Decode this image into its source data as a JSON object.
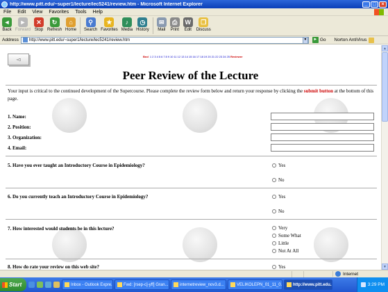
{
  "window": {
    "title": "http://www.pitt.edu/~super1/lecture/lec5241/review.htm - Microsoft Internet Explorer"
  },
  "menu": [
    "File",
    "Edit",
    "View",
    "Favorites",
    "Tools",
    "Help"
  ],
  "toolbar": [
    {
      "label": "Back",
      "icon": "back-arrow-icon",
      "color": "#3a9a3a",
      "glyph": "◄",
      "disabled": false
    },
    {
      "label": "Forward",
      "icon": "forward-arrow-icon",
      "color": "#b8b8b8",
      "glyph": "►",
      "disabled": true
    },
    {
      "label": "Stop",
      "icon": "stop-icon",
      "color": "#d23c2a",
      "glyph": "✕",
      "disabled": false
    },
    {
      "label": "Refresh",
      "icon": "refresh-icon",
      "color": "#3a9a3a",
      "glyph": "↻",
      "disabled": false
    },
    {
      "label": "Home",
      "icon": "home-icon",
      "color": "#e0a030",
      "glyph": "⌂",
      "disabled": false
    },
    {
      "label": "Search",
      "icon": "search-icon",
      "color": "#4a7bd0",
      "glyph": "⚲",
      "disabled": false
    },
    {
      "label": "Favorites",
      "icon": "favorites-star-icon",
      "color": "#e8b520",
      "glyph": "★",
      "disabled": false
    },
    {
      "label": "Media",
      "icon": "media-icon",
      "color": "#2f8f5a",
      "glyph": "♪",
      "disabled": false
    },
    {
      "label": "History",
      "icon": "history-icon",
      "color": "#2f7f8f",
      "glyph": "◷",
      "disabled": false
    },
    {
      "label": "Mail",
      "icon": "mail-icon",
      "color": "#8a9ab0",
      "glyph": "✉",
      "disabled": false
    },
    {
      "label": "Print",
      "icon": "print-icon",
      "color": "#8a8a8a",
      "glyph": "⎙",
      "disabled": false
    },
    {
      "label": "Edit",
      "icon": "edit-icon",
      "color": "#6a6a6a",
      "glyph": "W",
      "disabled": false
    },
    {
      "label": "Discuss",
      "icon": "discuss-icon",
      "color": "#e8c040",
      "glyph": "❐",
      "disabled": false
    }
  ],
  "address": {
    "label": "Address",
    "url": "http://www.pitt.edu/~super1/lecture/lec5241/review.htm",
    "go": "Go",
    "extra": "Norton AntiVirus"
  },
  "page": {
    "title": "Peer Review of the Lecture",
    "nav_first": "Bnd",
    "nav_pages": [
      "1",
      "2",
      "3",
      "4",
      "5",
      "6",
      "7",
      "8",
      "9",
      "10",
      "11",
      "12",
      "13",
      "14",
      "15",
      "16",
      "17",
      "18",
      "19",
      "20",
      "21",
      "22",
      "23",
      "24",
      "25"
    ],
    "nav_last": "Reviewer",
    "intro_before": "Your input is critical to the continued development of the Supercourse. Please complete the review form below and return your response by clicking the ",
    "intro_link": "submit button",
    "intro_after": " at the bottom of this page.",
    "fields": [
      "1. Name:",
      "2. Position:",
      "3. Organization:",
      "4. Email:"
    ],
    "q5": {
      "text": "5. Have you ever taught an Introductory Course in Epidemiology?",
      "options": [
        "Yes",
        "No"
      ]
    },
    "q6": {
      "text": "6. Do you currently teach an Introductory Course in Epidemiology?",
      "options": [
        "Yes",
        "No"
      ]
    },
    "q7": {
      "text": "7. How interested would students be in this lecture?",
      "options": [
        "Very",
        "Some What",
        "Little",
        "Not At All"
      ]
    },
    "q8": {
      "text": "8. How do rate your review on this web site?",
      "options": [
        "Yes"
      ]
    }
  },
  "status": {
    "zone": "Internet"
  },
  "taskbar": {
    "start": "Start",
    "tasks": [
      {
        "label": "Inbox - Outlook Expre...",
        "active": false
      },
      {
        "label": "Fwd: [rsep-c]-yff] Gran...",
        "active": false
      },
      {
        "label": "internetreview_nov3.d...",
        "active": false
      },
      {
        "label": "VELIKOLEPN_01_11_0...",
        "active": false
      },
      {
        "label": "http://www.pitt.edu...",
        "active": true
      }
    ],
    "clock": "3:29 PM"
  }
}
